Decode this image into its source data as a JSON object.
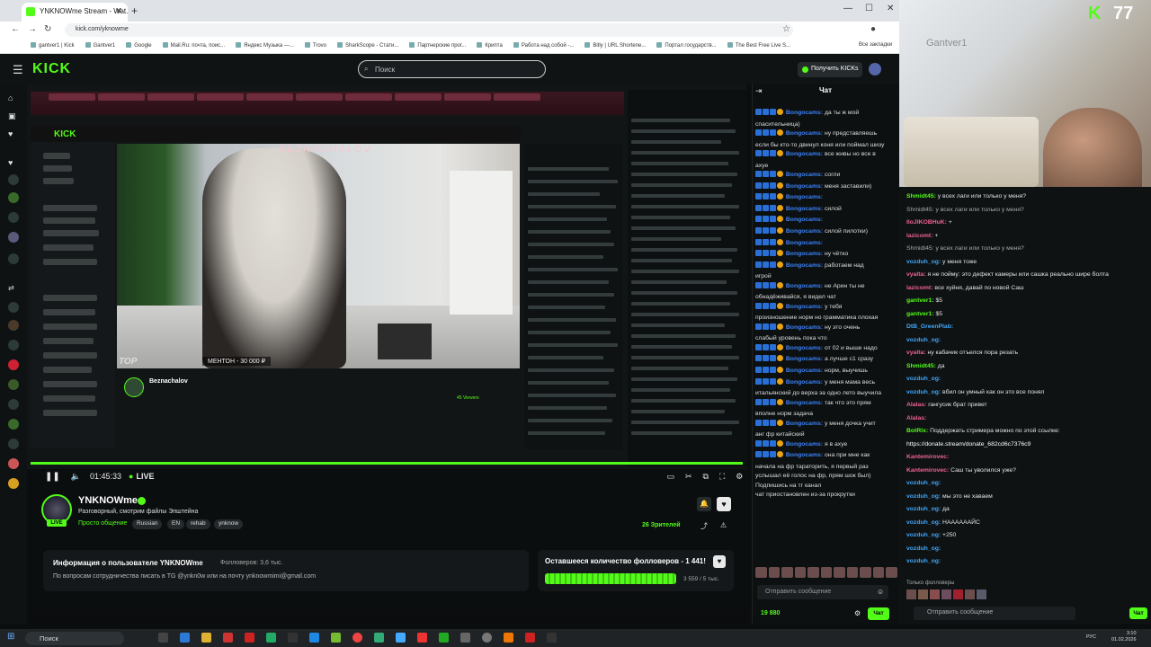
{
  "browser": {
    "tab_title": "YNKNOWme Stream - Wat...",
    "url": "kick.com/yknowme",
    "bookmarks": [
      "gantver1 | Kick",
      "Gantver1",
      "Google",
      "Mail.Ru: почта, поис...",
      "Яндекс Музыка —...",
      "Trovo",
      "SharkScope - Стати...",
      "Партнерские прог...",
      "Криптa",
      "Работа над собой -...",
      "Bitly | URL Shortene...",
      "Портал государств...",
      "The Best Free Live S..."
    ],
    "all_bookmarks": "Все закладки"
  },
  "kick": {
    "logo": "KICK",
    "search_placeholder": "Поиск",
    "get_kicks": "Получить KICKs"
  },
  "video": {
    "time": "01:45:33",
    "live": "LIVE",
    "inner_banner": "BEZNACHALOV",
    "caption_top": "TOP",
    "caption_bottom": "МЕНТОН - 30 000 ₽",
    "inner_channel": "Beznachalov",
    "inner_viewers": "45 Viewers"
  },
  "channel": {
    "name": "YNKNOWme",
    "title": "Разговорный, смотрим файлы Эпштейна",
    "category": "Просто общение",
    "tags": [
      "Russian",
      "EN",
      "rehab",
      "ynknow"
    ],
    "live_badge": "LIVE",
    "viewers": "26 Зрителей"
  },
  "about": {
    "title": "Информация о пользователе YNKNOWme",
    "followers": "Фолловеров: 3,6 тыс.",
    "desc": "По вопросам сотрудничества писать в TG @ynkn0w или на почту ynknowmimi@gmail.com"
  },
  "goal": {
    "title": "Оставшееся количество фолловеров - 1 441!",
    "value": "3 559 / 5 тыс.",
    "progress": 0.71
  },
  "chat": {
    "header": "Чат",
    "messages": [
      {
        "user": "Bongocams",
        "text": "да ты ж мой"
      },
      {
        "user": "",
        "text": "спасительница)"
      },
      {
        "user": "Bongocams",
        "text": "ну представляешь"
      },
      {
        "user": "",
        "text": "если бы кто-то двинул коня или поймал шизу"
      },
      {
        "user": "Bongocams",
        "text": "все живы но все в"
      },
      {
        "user": "",
        "text": "ахуе"
      },
      {
        "user": "Bongocams",
        "text": "согли"
      },
      {
        "user": "Bongocams",
        "text": "меня заставили)"
      },
      {
        "user": "Bongocams",
        "text": ""
      },
      {
        "user": "Bongocams",
        "text": "силой"
      },
      {
        "user": "Bongocams",
        "text": ""
      },
      {
        "user": "Bongocams",
        "text": "силой пилотки)"
      },
      {
        "user": "Bongocams",
        "text": ""
      },
      {
        "user": "Bongocams",
        "text": "ну чётко"
      },
      {
        "user": "Bongocams",
        "text": "работаем над"
      },
      {
        "user": "",
        "text": "игрой"
      },
      {
        "user": "Bongocams",
        "text": "не Арин ты не"
      },
      {
        "user": "",
        "text": "обнадёживайся, я видел чат"
      },
      {
        "user": "Bongocams",
        "text": "у тебя"
      },
      {
        "user": "",
        "text": "произношение норм но грамматика плохая"
      },
      {
        "user": "Bongocams",
        "text": "ну это очень"
      },
      {
        "user": "",
        "text": "слабый уровень пока что"
      },
      {
        "user": "Bongocams",
        "text": "от 02 и выше надо"
      },
      {
        "user": "Bongocams",
        "text": "а лучше с1 сразу"
      },
      {
        "user": "Bongocams",
        "text": "норм, выучишь"
      },
      {
        "user": "Bongocams",
        "text": "у меня мама весь"
      },
      {
        "user": "",
        "text": "итальянский до верха за одно лето выучила"
      },
      {
        "user": "Bongocams",
        "text": "так что это прям"
      },
      {
        "user": "",
        "text": "вполне норм задача"
      },
      {
        "user": "Bongocams",
        "text": "у меня дочка учит"
      },
      {
        "user": "",
        "text": "анг фр китайский"
      },
      {
        "user": "Bongocams",
        "text": "я в ахуе"
      },
      {
        "user": "Bongocams",
        "text": "она при мне как"
      },
      {
        "user": "",
        "text": "начала на фр тараторить, я первый раз"
      },
      {
        "user": "",
        "text": "услышал её голос на фр, прям шок был)"
      },
      {
        "user": "",
        "text": "Подпишись на тг канал"
      },
      {
        "user": "",
        "text": "чат приостановлен из-за прокрутки"
      }
    ],
    "send_placeholder": "Отправить сообщение",
    "kicks": "19 880",
    "chat_button": "Чат"
  },
  "camera": {
    "count": "77",
    "k": "K",
    "watermark": "Gantver1"
  },
  "chat2": {
    "messages": [
      {
        "user": "Shmidt45:",
        "text": "у всех лаги или только у меня?",
        "color": "#53fc18"
      },
      {
        "user": "",
        "text": "Shmidt45: у всех лаги или только у меня?",
        "color": "#aaa"
      },
      {
        "user": "IloJIKOBHuK:",
        "text": "+",
        "color": "#f06292"
      },
      {
        "user": "lazicomt:",
        "text": "+",
        "color": "#f06292"
      },
      {
        "user": "",
        "text": "Shmidt45: у всех лаги или только у меня?",
        "color": "#aaa"
      },
      {
        "user": "vozduh_og:",
        "text": "у меня тоже",
        "color": "#42a5f5"
      },
      {
        "user": "vyalta:",
        "text": "я не пойму: это дефект камеры или сашка реально шире болта",
        "color": "#f06292"
      },
      {
        "user": "lazicomt:",
        "text": "все хуйня, давай по новой Саш",
        "color": "#f06292"
      },
      {
        "user": "gantver1:",
        "text": "$5",
        "color": "#53fc18"
      },
      {
        "user": "gantver1:",
        "text": "$5",
        "color": "#53fc18"
      },
      {
        "user": "DtB_GreenPlab:",
        "text": "",
        "color": "#42a5f5"
      },
      {
        "user": "vozduh_og:",
        "text": "",
        "color": "#42a5f5"
      },
      {
        "user": "vyalta:",
        "text": "ну кабачик отъелся пора резать",
        "color": "#f06292"
      },
      {
        "user": "Shmidt45:",
        "text": "да",
        "color": "#53fc18"
      },
      {
        "user": "vozduh_og:",
        "text": "",
        "color": "#42a5f5"
      },
      {
        "user": "vozduh_og:",
        "text": "вбил он умный как он это все понял",
        "color": "#42a5f5"
      },
      {
        "user": "Alalas:",
        "text": "гангусик брат привет",
        "color": "#f06292"
      },
      {
        "user": "Alalas:",
        "text": "",
        "color": "#f06292"
      },
      {
        "user": "BotRix:",
        "text": "Поддержать стримера можно по этой ссылке:",
        "color": "#53fc18"
      },
      {
        "user": "",
        "text": "https://donate.stream/donate_682cd6c7376c9",
        "color": "#ffffff"
      },
      {
        "user": "Kantemirovec:",
        "text": "",
        "color": "#f06292"
      },
      {
        "user": "Kantemirovec:",
        "text": "Саш ты уволился уже?",
        "color": "#f06292"
      },
      {
        "user": "vozduh_og:",
        "text": "",
        "color": "#42a5f5"
      },
      {
        "user": "vozduh_og:",
        "text": "мы это не хаваем",
        "color": "#42a5f5"
      },
      {
        "user": "vozduh_og:",
        "text": "да",
        "color": "#42a5f5"
      },
      {
        "user": "vozduh_og:",
        "text": "НААААААЙС",
        "color": "#42a5f5"
      },
      {
        "user": "vozduh_og:",
        "text": "+250",
        "color": "#42a5f5"
      },
      {
        "user": "vozduh_og:",
        "text": "",
        "color": "#42a5f5"
      },
      {
        "user": "vozduh_og:",
        "text": "",
        "color": "#42a5f5"
      }
    ],
    "only_followers": "Только фолловеры",
    "send_placeholder": "Отправить сообщение",
    "chat_button": "Чат"
  },
  "taskbar": {
    "search": "Поиск",
    "lang": "РУС",
    "time": "3:10",
    "date": "01.02.2026"
  }
}
